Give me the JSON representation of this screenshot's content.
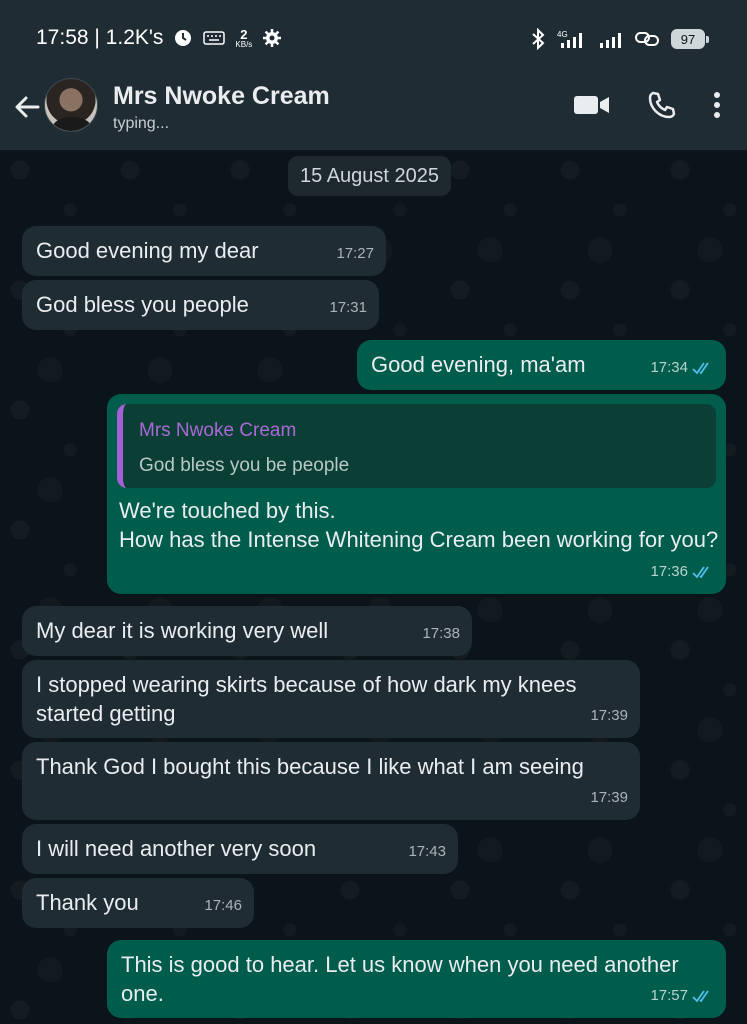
{
  "status_bar": {
    "time_netspeed": "17:58 | 1.2K's",
    "kbs_value": "2",
    "kbs_unit": "KB/s",
    "network": "4G",
    "battery": "97"
  },
  "header": {
    "contact_name": "Mrs Nwoke Cream",
    "status": "typing..."
  },
  "chat": {
    "date": "15 August 2025",
    "messages": [
      {
        "dir": "in",
        "text": "Good evening my dear",
        "time": "17:27"
      },
      {
        "dir": "in",
        "text": "God bless you people",
        "time": "17:31"
      },
      {
        "dir": "out",
        "text": "Good evening, ma'am",
        "time": "17:34"
      },
      {
        "dir": "out",
        "quote_name": "Mrs Nwoke Cream",
        "quote_text": "God bless you be people",
        "text": "We're touched by this.\nHow has the Intense Whitening Cream been working for you?",
        "time": "17:36"
      },
      {
        "dir": "in",
        "text": "My dear it is working very well",
        "time": "17:38"
      },
      {
        "dir": "in",
        "text": "I stopped wearing skirts because of how dark my knees started getting",
        "time": "17:39"
      },
      {
        "dir": "in",
        "text": "Thank God I bought this because I like what I am seeing",
        "time": "17:39"
      },
      {
        "dir": "in",
        "text": "I will need another very soon",
        "time": "17:43"
      },
      {
        "dir": "in",
        "text": "Thank you",
        "time": "17:46"
      },
      {
        "dir": "out",
        "text": "This is good to hear. Let us know when you need another one.",
        "time": "17:57"
      }
    ]
  },
  "colors": {
    "incoming_bubble": "#1f2c34",
    "outgoing_bubble": "#005c4b",
    "read_ticks": "#53bdeb",
    "quote_accent": "#a65fd6"
  },
  "icons": [
    "alarm-icon",
    "keyboard-icon",
    "gear-icon",
    "bluetooth-icon",
    "signal-icon",
    "link-icon",
    "back-arrow-icon",
    "video-call-icon",
    "phone-icon",
    "more-vert-icon",
    "double-check-icon"
  ]
}
